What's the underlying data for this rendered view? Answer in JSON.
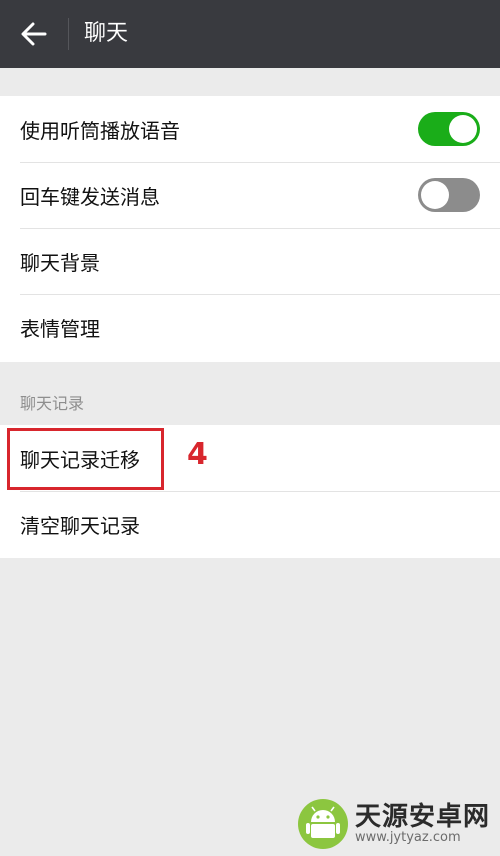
{
  "header": {
    "title": "聊天",
    "back_icon": "arrow-left-icon"
  },
  "settings": {
    "group1": [
      {
        "label": "使用听筒播放语音",
        "toggle": true
      },
      {
        "label": "回车键发送消息",
        "toggle": false
      },
      {
        "label": "聊天背景"
      },
      {
        "label": "表情管理"
      }
    ],
    "section_title": "聊天记录",
    "group2": [
      {
        "label": "聊天记录迁移"
      },
      {
        "label": "清空聊天记录"
      }
    ]
  },
  "annotation": {
    "number": "4",
    "color": "#d8262d"
  },
  "watermark": {
    "name": "天源安卓网",
    "url": "www.jytyaz.com",
    "logo_icon": "android-logo-icon"
  },
  "colors": {
    "app_bar": "#393a3f",
    "toggle_on": "#1aad19",
    "toggle_off": "#8c8c8c",
    "background": "#ebebeb"
  }
}
